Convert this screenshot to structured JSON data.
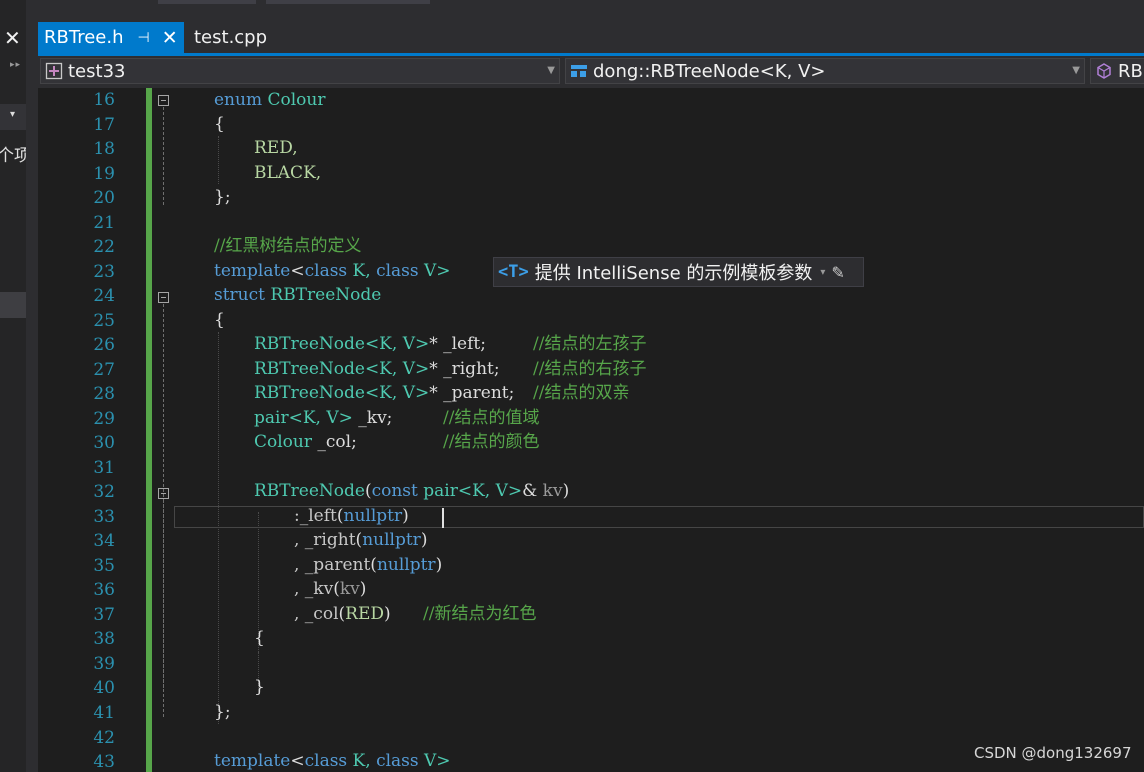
{
  "side_panel": {
    "close_glyph": "✕",
    "pin_glyph": "▸▸",
    "dropdown_glyph": "▾",
    "partial_text": "个项"
  },
  "tabs": [
    {
      "label": "RBTree.h",
      "pin_glyph": "⊣",
      "close_glyph": "✕",
      "active": true
    },
    {
      "label": "test.cpp",
      "active": false
    }
  ],
  "navbar": {
    "project": {
      "value": "test33",
      "icon": "project-icon"
    },
    "scope": {
      "value": "dong::RBTreeNode<K, V>",
      "icon": "struct-icon"
    },
    "member": {
      "value": "RB",
      "icon": "member-cube-icon"
    },
    "arrow_glyph": "▼"
  },
  "editor": {
    "line_numbers": [
      "16",
      "17",
      "18",
      "19",
      "20",
      "21",
      "22",
      "23",
      "24",
      "25",
      "26",
      "27",
      "28",
      "29",
      "30",
      "31",
      "32",
      "33",
      "34",
      "35",
      "36",
      "37",
      "38",
      "39",
      "40",
      "41",
      "42",
      "43"
    ],
    "lines": {
      "l16": {
        "kw": "enum",
        "name": "Colour"
      },
      "l17": {
        "brace": "{"
      },
      "l18": {
        "value": "RED,"
      },
      "l19": {
        "value": "BLACK,"
      },
      "l20": {
        "brace": "};"
      },
      "l22": {
        "comment": "//红黑树结点的定义"
      },
      "l23": {
        "kw1": "template",
        "lt": "<",
        "kw2": "class",
        "p1": " K, ",
        "kw3": "class",
        "p2": " V>"
      },
      "l24": {
        "kw": "struct",
        "name": "RBTreeNode"
      },
      "l25": {
        "brace": "{"
      },
      "l26": {
        "type": "RBTreeNode",
        "targs": "<K, V>",
        "rest": "* _left;",
        "comment": "//结点的左孩子"
      },
      "l27": {
        "type": "RBTreeNode",
        "targs": "<K, V>",
        "rest": "* _right;",
        "comment": "//结点的右孩子"
      },
      "l28": {
        "type": "RBTreeNode",
        "targs": "<K, V>",
        "rest": "* _parent;",
        "comment": "//结点的双亲"
      },
      "l29": {
        "type": "pair",
        "targs": "<K, V>",
        "rest": " _kv;",
        "comment": "//结点的值域"
      },
      "l30": {
        "type": "Colour",
        "rest": " _col;",
        "comment": "//结点的颜色"
      },
      "l32": {
        "name": "RBTreeNode",
        "open": "(",
        "kw": "const",
        "type": "pair",
        "targs": "<K, V>",
        "amp": "& ",
        "param": "kv",
        "close": ")"
      },
      "l33": {
        "member": ":_left",
        "open": "(",
        "kw": "nullptr",
        "close": ")"
      },
      "l34": {
        "member": ", _right",
        "open": "(",
        "kw": "nullptr",
        "close": ")"
      },
      "l35": {
        "member": ", _parent",
        "open": "(",
        "kw": "nullptr",
        "close": ")"
      },
      "l36": {
        "member": ", _kv",
        "open": "(",
        "param": "kv",
        "close": ")"
      },
      "l37": {
        "member": ", _col",
        "open": "(",
        "enumval": "RED",
        "close": ")",
        "comment": "//新结点为红色"
      },
      "l38": {
        "brace": "{"
      },
      "l40": {
        "brace": "}"
      },
      "l41": {
        "brace": "};"
      },
      "l43": {
        "kw1": "template",
        "lt": "<",
        "kw2": "class",
        "p1": " K, ",
        "kw3": "class",
        "p2": " V>"
      }
    }
  },
  "intellisense_hint": {
    "tag": "<T>",
    "text": "提供 IntelliSense 的示例模板参数",
    "dropdown_glyph": "▾",
    "edit_glyph": "✎"
  },
  "watermark": "CSDN @dong132697",
  "colors": {
    "accent": "#007acc",
    "keyword": "#569cd6",
    "type": "#4ec9b0",
    "comment": "#57a64a",
    "line_number": "#2b91af",
    "enum_value": "#b8d7a3"
  }
}
